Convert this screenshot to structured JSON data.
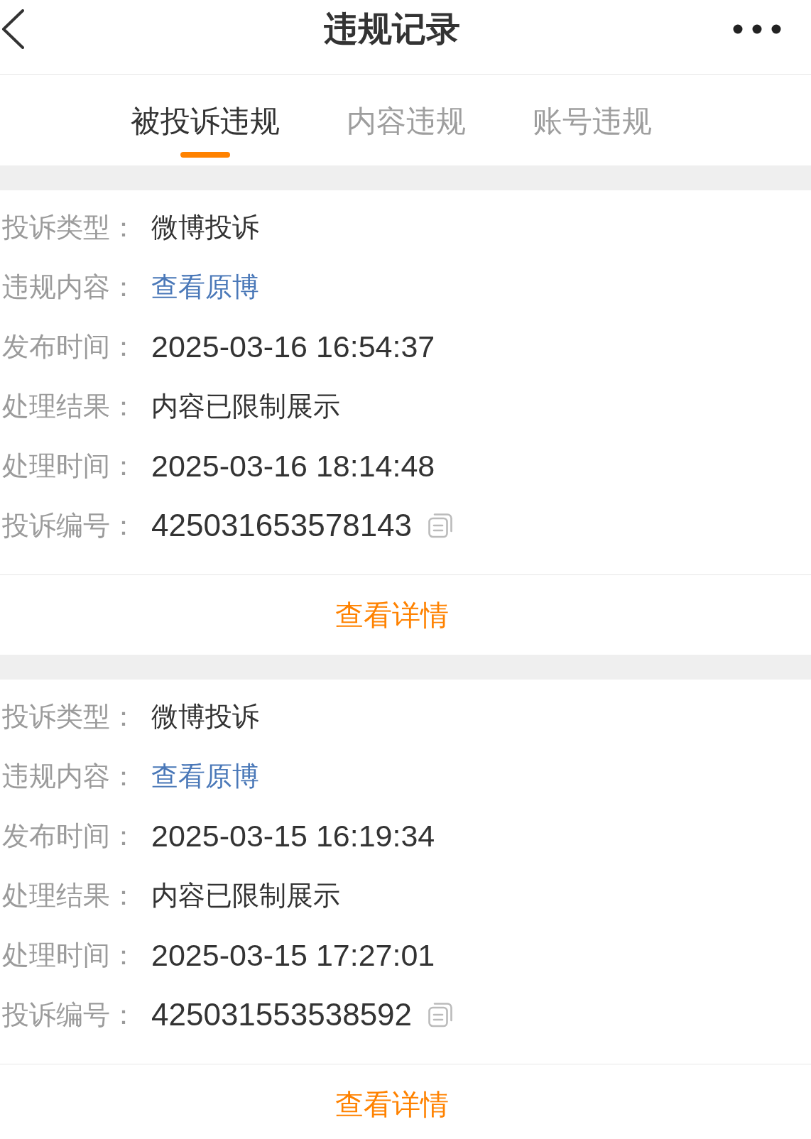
{
  "header": {
    "title": "违规记录"
  },
  "tabs": [
    {
      "label": "被投诉违规",
      "selected": true
    },
    {
      "label": "内容违规",
      "selected": false
    },
    {
      "label": "账号违规",
      "selected": false
    }
  ],
  "records": [
    {
      "fields": [
        {
          "label": "投诉类型：",
          "value": "微博投诉",
          "kind": "text"
        },
        {
          "label": "违规内容：",
          "value": "查看原博",
          "kind": "link"
        },
        {
          "label": "发布时间：",
          "value": "2025-03-16 16:54:37",
          "kind": "time"
        },
        {
          "label": "处理结果：",
          "value": "内容已限制展示",
          "kind": "text"
        },
        {
          "label": "处理时间：",
          "value": "2025-03-16 18:14:48",
          "kind": "time"
        },
        {
          "label": "投诉编号：",
          "value": "425031653578143",
          "kind": "code"
        }
      ],
      "action": "查看详情"
    },
    {
      "fields": [
        {
          "label": "投诉类型：",
          "value": "微博投诉",
          "kind": "text"
        },
        {
          "label": "违规内容：",
          "value": "查看原博",
          "kind": "link"
        },
        {
          "label": "发布时间：",
          "value": "2025-03-15 16:19:34",
          "kind": "time"
        },
        {
          "label": "处理结果：",
          "value": "内容已限制展示",
          "kind": "text"
        },
        {
          "label": "处理时间：",
          "value": "2025-03-15 17:27:01",
          "kind": "time"
        },
        {
          "label": "投诉编号：",
          "value": "425031553538592",
          "kind": "code"
        }
      ],
      "action": "查看详情"
    }
  ]
}
